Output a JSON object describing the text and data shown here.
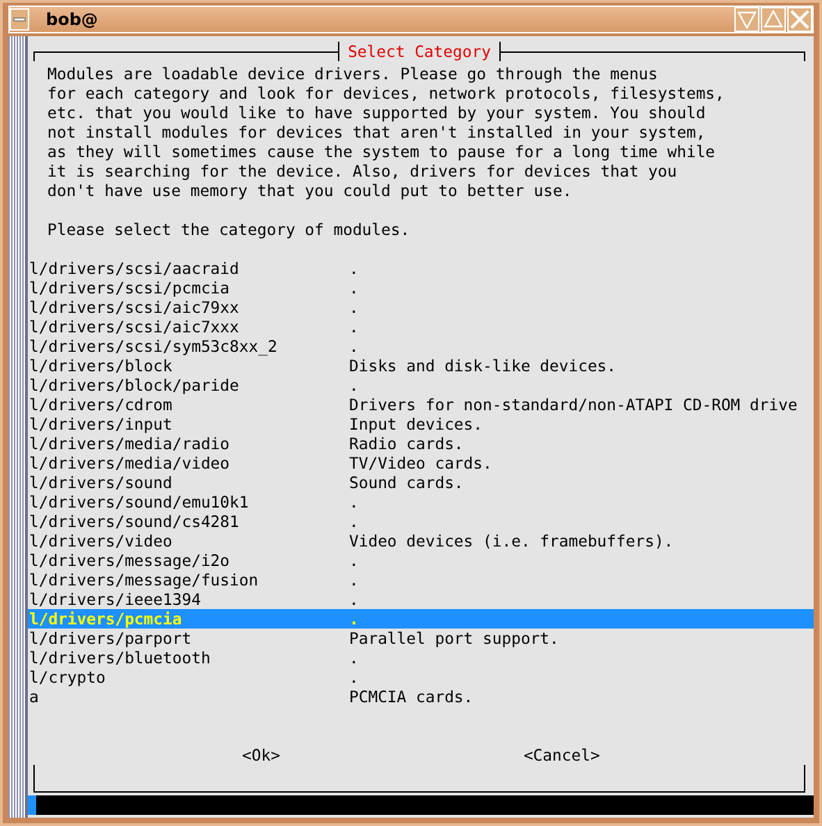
{
  "window": {
    "title": "bob@"
  },
  "dialog": {
    "title": "Select Category",
    "intro": "Modules are loadable device drivers. Please go through the menus\nfor each category and look for devices, network protocols, filesystems,\netc. that you would like to have supported by your system. You should\nnot install modules for devices that aren't installed in your system,\nas they will sometimes cause the system to pause for a long time while\nit is searching for the device. Also, drivers for devices that you\ndon't have use memory that you could put to better use.",
    "prompt": "Please select the category of modules.",
    "rows": [
      {
        "path": "l/drivers/scsi/aacraid",
        "description": ".",
        "selected": false
      },
      {
        "path": "l/drivers/scsi/pcmcia",
        "description": ".",
        "selected": false
      },
      {
        "path": "l/drivers/scsi/aic79xx",
        "description": ".",
        "selected": false
      },
      {
        "path": "l/drivers/scsi/aic7xxx",
        "description": ".",
        "selected": false
      },
      {
        "path": "l/drivers/scsi/sym53c8xx_2",
        "description": ".",
        "selected": false
      },
      {
        "path": "l/drivers/block",
        "description": "Disks and disk-like devices.",
        "selected": false
      },
      {
        "path": "l/drivers/block/paride",
        "description": ".",
        "selected": false
      },
      {
        "path": "l/drivers/cdrom",
        "description": "Drivers for non-standard/non-ATAPI CD-ROM drive",
        "selected": false
      },
      {
        "path": "l/drivers/input",
        "description": "Input devices.",
        "selected": false
      },
      {
        "path": "l/drivers/media/radio",
        "description": "Radio cards.",
        "selected": false
      },
      {
        "path": "l/drivers/media/video",
        "description": "TV/Video cards.",
        "selected": false
      },
      {
        "path": "l/drivers/sound",
        "description": "Sound cards.",
        "selected": false
      },
      {
        "path": "l/drivers/sound/emu10k1",
        "description": ".",
        "selected": false
      },
      {
        "path": "l/drivers/sound/cs4281",
        "description": ".",
        "selected": false
      },
      {
        "path": "l/drivers/video",
        "description": "Video devices (i.e. framebuffers).",
        "selected": false
      },
      {
        "path": "l/drivers/message/i2o",
        "description": ".",
        "selected": false
      },
      {
        "path": "l/drivers/message/fusion",
        "description": ".",
        "selected": false
      },
      {
        "path": "l/drivers/ieee1394",
        "description": ".",
        "selected": false
      },
      {
        "path": "l/drivers/pcmcia",
        "description": ".",
        "selected": true
      },
      {
        "path": "l/drivers/parport",
        "description": "Parallel port support.",
        "selected": false
      },
      {
        "path": "l/drivers/bluetooth",
        "description": ".",
        "selected": false
      },
      {
        "path": "l/crypto",
        "description": ".",
        "selected": false
      },
      {
        "path": "a",
        "description": "PCMCIA cards.",
        "selected": false
      }
    ],
    "buttons": [
      "<Ok>",
      "<Cancel>"
    ]
  }
}
